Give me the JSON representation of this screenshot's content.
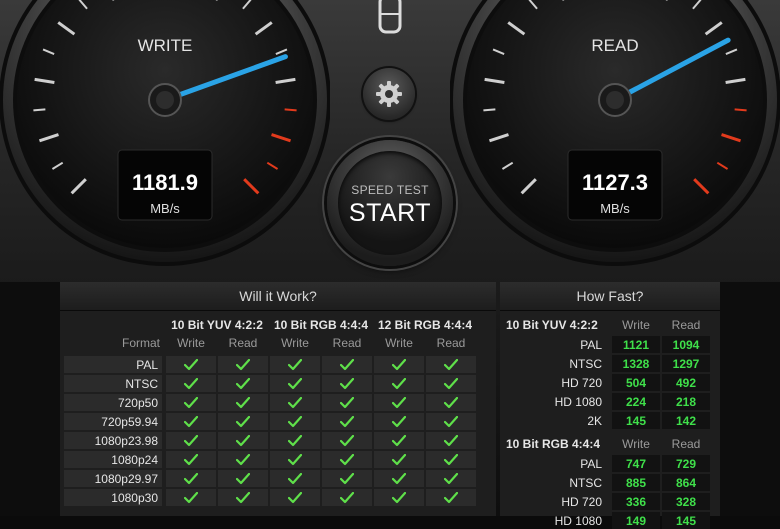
{
  "gauges": {
    "write": {
      "label": "WRITE",
      "value": "1181.9",
      "unit": "MB/s",
      "needle_fraction": 0.76
    },
    "read": {
      "label": "READ",
      "value": "1127.3",
      "unit": "MB/s",
      "needle_fraction": 0.73
    }
  },
  "start_button": {
    "subtitle": "SPEED TEST",
    "label": "START"
  },
  "icons": {
    "settings": "gear-icon",
    "check": "checkmark-icon",
    "top": "drive-icon"
  },
  "colors": {
    "check": "#5fe04a",
    "needle": "#2aa3e6",
    "value_green": "#3fe04a",
    "redline": "#e23a1c"
  },
  "will_it_work": {
    "title": "Will it Work?",
    "format_header": "Format",
    "groups": [
      {
        "name": "10 Bit YUV 4:2:2",
        "cols": [
          "Write",
          "Read"
        ]
      },
      {
        "name": "10 Bit RGB 4:4:4",
        "cols": [
          "Write",
          "Read"
        ]
      },
      {
        "name": "12 Bit RGB 4:4:4",
        "cols": [
          "Write",
          "Read"
        ]
      }
    ],
    "rows": [
      "PAL",
      "NTSC",
      "720p50",
      "720p59.94",
      "1080p23.98",
      "1080p24",
      "1080p29.97",
      "1080p30"
    ]
  },
  "how_fast": {
    "title": "How Fast?",
    "sections": [
      {
        "name": "10 Bit YUV 4:2:2",
        "cols": [
          "Write",
          "Read"
        ],
        "rows": [
          {
            "label": "PAL",
            "write": "1121",
            "read": "1094"
          },
          {
            "label": "NTSC",
            "write": "1328",
            "read": "1297"
          },
          {
            "label": "HD 720",
            "write": "504",
            "read": "492"
          },
          {
            "label": "HD 1080",
            "write": "224",
            "read": "218"
          },
          {
            "label": "2K",
            "write": "145",
            "read": "142"
          }
        ]
      },
      {
        "name": "10 Bit RGB 4:4:4",
        "cols": [
          "Write",
          "Read"
        ],
        "rows": [
          {
            "label": "PAL",
            "write": "747",
            "read": "729"
          },
          {
            "label": "NTSC",
            "write": "885",
            "read": "864"
          },
          {
            "label": "HD 720",
            "write": "336",
            "read": "328"
          },
          {
            "label": "HD 1080",
            "write": "149",
            "read": "145"
          }
        ]
      }
    ]
  }
}
